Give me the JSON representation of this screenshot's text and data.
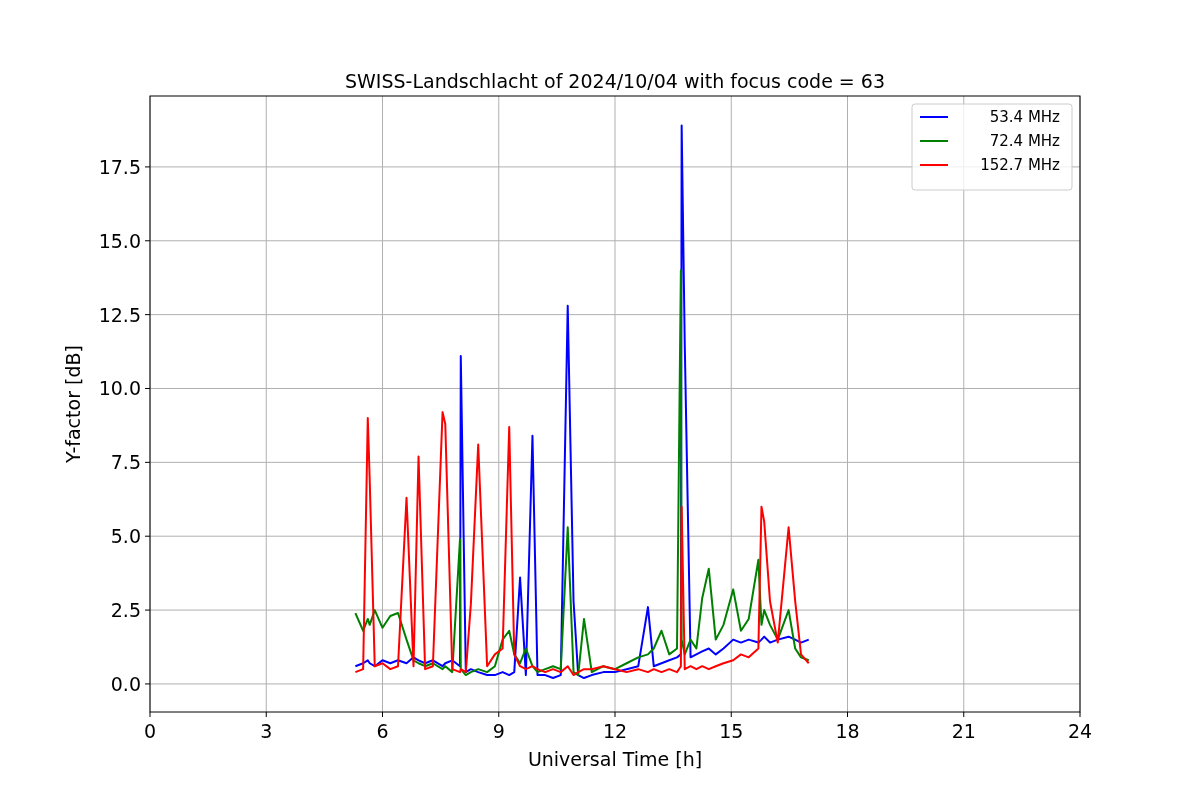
{
  "figure": {
    "chart_data": {
      "type": "line",
      "title": "SWISS-Landschlacht of 2024/10/04 with focus code = 63",
      "xlabel": "Universal Time [h]",
      "ylabel": "Y-factor [dB]",
      "x": [
        5.3,
        5.5,
        5.62,
        5.67,
        5.8,
        6.0,
        6.2,
        6.4,
        6.62,
        6.8,
        6.93,
        7.1,
        7.3,
        7.55,
        7.62,
        7.8,
        8.0,
        8.02,
        8.15,
        8.28,
        8.47,
        8.7,
        8.9,
        9.1,
        9.27,
        9.4,
        9.55,
        9.7,
        9.87,
        10.0,
        10.2,
        10.4,
        10.6,
        10.78,
        10.93,
        11.05,
        11.2,
        11.4,
        11.7,
        12.0,
        12.3,
        12.6,
        12.85,
        13.0,
        13.2,
        13.4,
        13.6,
        13.7,
        13.72,
        13.8,
        13.95,
        14.1,
        14.25,
        14.42,
        14.6,
        14.8,
        15.05,
        15.25,
        15.45,
        15.7,
        15.78,
        15.85,
        16.0,
        16.2,
        16.48,
        16.65,
        16.8,
        17.0
      ],
      "series": [
        {
          "name": "53.4 MHz",
          "color": "#0000ff",
          "values": [
            0.6,
            0.7,
            0.8,
            0.7,
            0.6,
            0.8,
            0.7,
            0.8,
            0.7,
            0.9,
            0.8,
            0.7,
            0.8,
            0.6,
            0.7,
            0.8,
            0.6,
            11.1,
            0.4,
            0.5,
            0.4,
            0.3,
            0.3,
            0.4,
            0.3,
            0.4,
            3.6,
            0.3,
            8.4,
            0.3,
            0.3,
            0.2,
            0.3,
            12.8,
            2.8,
            0.3,
            0.2,
            0.3,
            0.4,
            0.4,
            0.5,
            0.6,
            2.6,
            0.6,
            0.7,
            0.8,
            0.9,
            1.0,
            18.9,
            11.5,
            0.9,
            1.0,
            1.1,
            1.2,
            1.0,
            1.2,
            1.5,
            1.4,
            1.5,
            1.4,
            1.5,
            1.6,
            1.4,
            1.5,
            1.6,
            1.5,
            1.4,
            1.5
          ]
        },
        {
          "name": "72.4 MHz",
          "color": "#008000",
          "values": [
            2.4,
            1.8,
            2.2,
            2.0,
            2.5,
            1.9,
            2.3,
            2.4,
            1.5,
            0.8,
            0.7,
            0.6,
            0.7,
            0.5,
            0.6,
            0.4,
            4.9,
            0.5,
            0.3,
            0.4,
            0.5,
            0.4,
            0.6,
            1.5,
            1.8,
            1.0,
            0.7,
            1.2,
            0.6,
            0.4,
            0.5,
            0.6,
            0.5,
            5.3,
            0.4,
            0.3,
            2.2,
            0.4,
            0.6,
            0.5,
            0.7,
            0.9,
            1.0,
            1.2,
            1.8,
            1.0,
            1.2,
            14.0,
            1.5,
            1.0,
            1.5,
            1.2,
            2.9,
            3.9,
            1.5,
            2.0,
            3.2,
            1.8,
            2.2,
            4.2,
            2.0,
            2.5,
            2.0,
            1.5,
            2.5,
            1.2,
            0.9,
            0.8
          ]
        },
        {
          "name": "152.7 MHz",
          "color": "#ff0000",
          "values": [
            0.4,
            0.5,
            9.0,
            6.9,
            0.6,
            0.7,
            0.5,
            0.6,
            6.3,
            0.6,
            7.7,
            0.5,
            0.6,
            9.2,
            8.8,
            0.5,
            0.4,
            0.5,
            0.4,
            2.7,
            8.1,
            0.6,
            1.0,
            1.2,
            8.7,
            1.0,
            0.6,
            0.5,
            0.6,
            0.5,
            0.4,
            0.5,
            0.4,
            0.6,
            0.3,
            0.4,
            0.5,
            0.5,
            0.6,
            0.5,
            0.4,
            0.5,
            0.4,
            0.5,
            0.4,
            0.5,
            0.4,
            0.6,
            6.0,
            0.5,
            0.6,
            0.5,
            0.6,
            0.5,
            0.6,
            0.7,
            0.8,
            1.0,
            0.9,
            1.2,
            6.0,
            5.5,
            2.8,
            1.4,
            5.3,
            2.8,
            1.0,
            0.7
          ]
        }
      ],
      "grid": true,
      "xlim": [
        0,
        24
      ],
      "ylim": [
        -0.95,
        19.9
      ],
      "xticks": [
        0,
        3,
        6,
        9,
        12,
        15,
        18,
        21,
        24
      ],
      "yticks": [
        {
          "value": 0,
          "label": "0.0"
        },
        {
          "value": 2.5,
          "label": "2.5"
        },
        {
          "value": 5,
          "label": "5.0"
        },
        {
          "value": 7.5,
          "label": "7.5"
        },
        {
          "value": 10,
          "label": "10.0"
        },
        {
          "value": 12.5,
          "label": "12.5"
        },
        {
          "value": 15,
          "label": "15.0"
        },
        {
          "value": 17.5,
          "label": "17.5"
        }
      ]
    }
  }
}
